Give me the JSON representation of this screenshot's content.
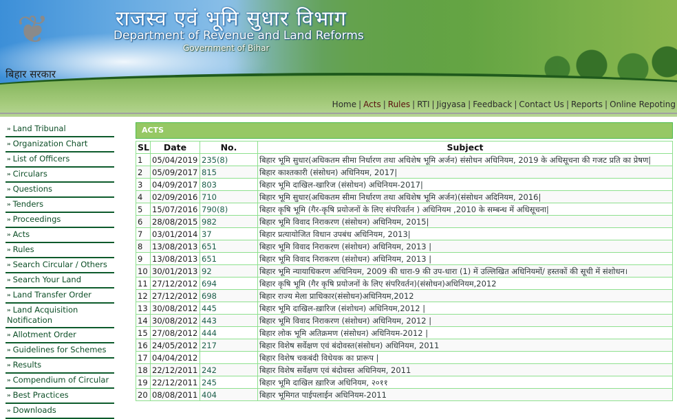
{
  "header": {
    "title_hindi": "राजस्व एवं भूमि सुधार विभाग",
    "title_english": "Department of Revenue and Land Reforms",
    "subtitle": "Government of Bihar",
    "logo_caption": "बिहार सरकार",
    "logo_icon": "bodhi-tree-emblem"
  },
  "topnav": [
    {
      "label": "Home",
      "style": "normal"
    },
    {
      "label": "Acts",
      "style": "dark"
    },
    {
      "label": "Rules",
      "style": "dark"
    },
    {
      "label": "RTI",
      "style": "normal"
    },
    {
      "label": "Jigyasa",
      "style": "normal"
    },
    {
      "label": "Feedback",
      "style": "normal"
    },
    {
      "label": "Contact Us",
      "style": "normal"
    },
    {
      "label": "Reports",
      "style": "normal"
    },
    {
      "label": "Online Repoting",
      "style": "normal"
    }
  ],
  "sidebar": {
    "bullet_icon": "double-chevron-right",
    "items": [
      "Land Tribunal",
      "Organization Chart",
      "List of Officers",
      "Circulars",
      "Questions",
      "Tenders",
      "Proceedings",
      "Acts",
      "Rules",
      "Search Circular / Others",
      "Search Your Land",
      "Land Transfer Order",
      "Land Acquisition Notification",
      "Allotment Order",
      "Guidelines for Schemes",
      "Results",
      "Compendium of Circular",
      "Best Practices",
      "Downloads"
    ]
  },
  "main": {
    "section_title": "ACTS",
    "columns": [
      "SL",
      "Date",
      "No.",
      "Subject"
    ],
    "rows": [
      [
        "1",
        "05/04/2019",
        "235(8)",
        "बिहार भूमि सुधार(अधिकतम सीमा निर्धारण तथा अधिशेष भूमि अर्जन) संसोधन अधिनियम, 2019 के अधिसूचना की गजट प्रति का प्रेषण|"
      ],
      [
        "2",
        "05/09/2017",
        "815",
        "बिहार काश्तकारी (संसोधन) अधिनियम, 2017|"
      ],
      [
        "3",
        "04/09/2017",
        "803",
        "बिहार भूमि दाखिल-खारिज (संसोधन) अधिनियम-2017|"
      ],
      [
        "4",
        "02/09/2016",
        "710",
        "बिहार भूमि सुधार(अधिकतम सीमा निर्धारण तथा अधिशेष भूमि अर्जन)(संसोधन अदिनियम, 2016|"
      ],
      [
        "5",
        "15/07/2016",
        "790(8)",
        "बिहार कृषि भूमि (गैर-कृषि प्रयोजनों के लिए संपरिवर्तन ) अधिनियम ,2010 के सम्बन्ध में अधिसूचना|"
      ],
      [
        "6",
        "28/08/2015",
        "982",
        "बिहार भूमि विवाद निराकरण (संसोधन) अधिनियम, 2015|"
      ],
      [
        "7",
        "03/01/2014",
        "37",
        "बिहार प्रत्यायोजित विधान उपबंध अधिनियम, 2013|"
      ],
      [
        "8",
        "13/08/2013",
        "651",
        "बिहार भूमि विवाद निराकरण (संशोधन) अधिनियम, 2013 |"
      ],
      [
        "9",
        "13/08/2013",
        "651",
        "बिहार भूमि विवाद निराकरण (संशोधन) अधिनियम, 2013 |"
      ],
      [
        "10",
        "30/01/2013",
        "92",
        "बिहार भूमि न्यायाधिकरण अधिनियम, 2009 की धारा-9 की उप-धारा (1) में उल्लिखित अधिनियमों/ हस्तकों की सूची में संशोधन।"
      ],
      [
        "11",
        "27/12/2012",
        "694",
        "बिहार कृषि भूमि (गैर कृषि प्रयोजनों के लिए संपरिवर्तन)(संसोधन)अधिनियम,2012"
      ],
      [
        "12",
        "27/12/2012",
        "698",
        "बिहार राज्य मेला प्राधिकार(संसोधन)अधिनियम,2012"
      ],
      [
        "13",
        "30/08/2012",
        "445",
        "बिहार भूमि दाखिल-ख़ारिज (संशोधन) अधिनियम,2012 |"
      ],
      [
        "14",
        "30/08/2012",
        "443",
        "बिहार भूमि विवाद निराकरण (संशोधन) अधिनियम, 2012 |"
      ],
      [
        "15",
        "27/08/2012",
        "444",
        "बिहार लोक भूमि अतिक्रमण (संसोधन) अधिनियम-2012 |"
      ],
      [
        "16",
        "24/05/2012",
        "217",
        "बिहार विशेष सर्वेक्षण एवं बंदोवस्त(संसोधन) अधिनियम, 2011"
      ],
      [
        "17",
        "04/04/2012",
        "",
        "बिहार विशेष चकबंदी विधेयक का प्रारूप |"
      ],
      [
        "18",
        "22/12/2011",
        "242",
        "बिहार विशेष सर्वेक्षण एवं बंदोवस्त अधिनियम, 2011"
      ],
      [
        "19",
        "22/12/2011",
        "245",
        "बिहार भूमि दाखिल ख़ारिज अधिनियम, २०११"
      ],
      [
        "20",
        "08/08/2011",
        "404",
        "बिहार भूमिगत पाईपलाईन अधिनियम-2011"
      ]
    ]
  }
}
